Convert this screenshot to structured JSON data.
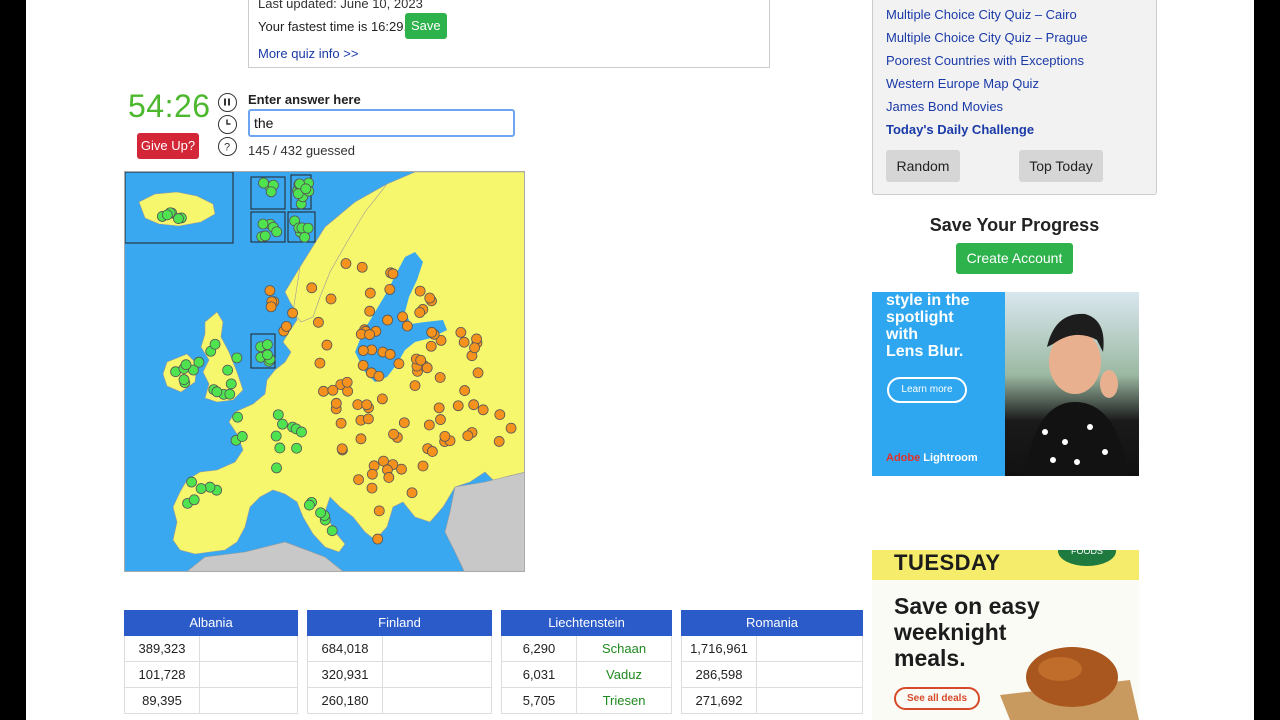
{
  "quiz_info": {
    "last_updated": "Last updated: June 10, 2023",
    "fastest_time_text": "Your fastest time is 16:29.",
    "save_label": "Save",
    "more_info_link": "More quiz info >>"
  },
  "quiz": {
    "timer": "54:26",
    "give_up_label": "Give Up?",
    "enter_label": "Enter answer here",
    "answer_value": "the",
    "guessed_text": "145 / 432 guessed"
  },
  "colors": {
    "sea": "#3aa8f0",
    "land_quiz": "#f7f76e",
    "land_other": "#c8c8c8",
    "dot_guessed": "#4fe44f",
    "dot_missing": "#f5921e",
    "table_header": "#2a5bc9",
    "answer_text": "#1f8a1f"
  },
  "tables": [
    {
      "country": "Albania",
      "rows": [
        {
          "population": "389,323",
          "city": ""
        },
        {
          "population": "101,728",
          "city": ""
        },
        {
          "population": "89,395",
          "city": ""
        }
      ]
    },
    {
      "country": "Finland",
      "rows": [
        {
          "population": "684,018",
          "city": ""
        },
        {
          "population": "320,931",
          "city": ""
        },
        {
          "population": "260,180",
          "city": ""
        }
      ]
    },
    {
      "country": "Liechtenstein",
      "rows": [
        {
          "population": "6,290",
          "city": "Schaan"
        },
        {
          "population": "6,031",
          "city": "Vaduz"
        },
        {
          "population": "5,705",
          "city": "Triesen"
        }
      ]
    },
    {
      "country": "Romania",
      "rows": [
        {
          "population": "1,716,961",
          "city": ""
        },
        {
          "population": "286,598",
          "city": ""
        },
        {
          "population": "271,692",
          "city": ""
        }
      ]
    }
  ],
  "sidebar": {
    "links": [
      "Multiple Choice City Quiz – Cairo",
      "Multiple Choice City Quiz – Prague",
      "Poorest Countries with Exceptions",
      "Western Europe Map Quiz",
      "James Bond Movies"
    ],
    "daily_challenge": "Today's Daily Challenge",
    "random_label": "Random",
    "top_today_label": "Top Today"
  },
  "account": {
    "heading": "Save Your Progress",
    "create_label": "Create Account"
  },
  "ad_lightroom": {
    "headline_1": "style in the",
    "headline_2": "spotlight",
    "headline_3": "with",
    "headline_4": "Lens Blur.",
    "cta": "Learn more",
    "brand_adobe": "Adobe",
    "brand_product": " Lightroom"
  },
  "ad_foods": {
    "day": "TUESDAY",
    "logo": "FOODS",
    "copy_1": "Save on easy",
    "copy_2": "weeknight",
    "copy_3": "meals.",
    "cta": "See all deals"
  }
}
